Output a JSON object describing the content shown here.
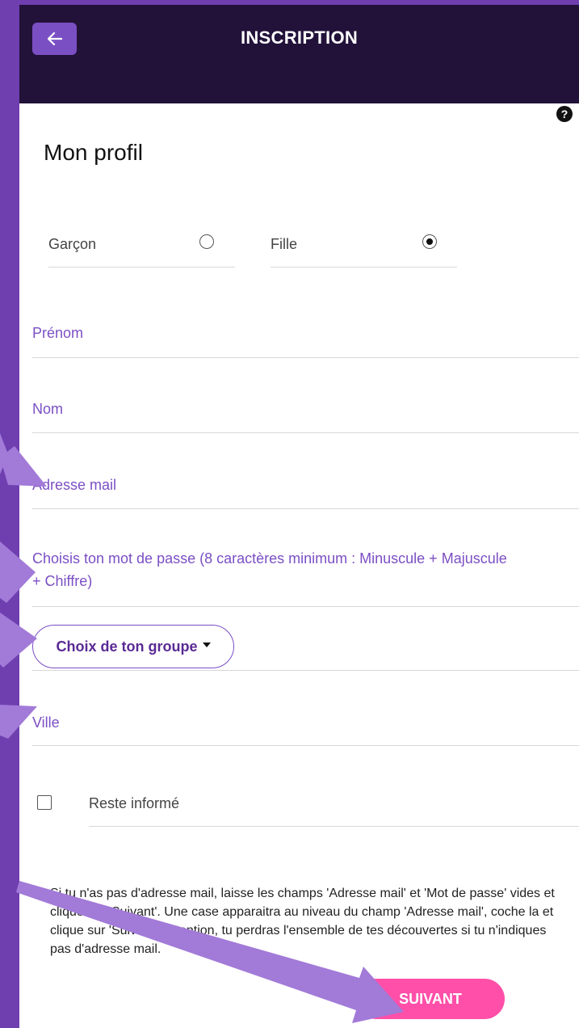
{
  "header": {
    "title": "INSCRIPTION",
    "back_icon": "arrow-left-icon",
    "help_icon": "question-circle-icon"
  },
  "page": {
    "title": "Mon profil"
  },
  "gender": {
    "options": [
      {
        "label": "Garçon",
        "selected": false
      },
      {
        "label": "Fille",
        "selected": true
      }
    ]
  },
  "form": {
    "first_name_label": "Prénom",
    "last_name_label": "Nom",
    "email_label": "Adresse mail",
    "password_label": "Choisis ton mot de passe (8 caractères minimum : Minuscule + Majuscule + Chiffre)",
    "group_button_label": "Choix de ton groupe",
    "city_label": "Ville",
    "stay_informed_label": "Reste informé",
    "stay_informed_checked": false
  },
  "notice": "Si tu n'as pas d'adresse mail, laisse les champs 'Adresse mail' et 'Mot de passe' vides et clique sur 'Suivant'. Une case apparaitra au niveau du champ 'Adresse mail', coche la et clique sur 'Suivant'. Attention, tu perdras l'ensemble de tes découvertes si tu n'indiques pas d'adresse mail.",
  "actions": {
    "next_label": "SUIVANT"
  },
  "colors": {
    "header_bg": "#22123a",
    "accent": "#7b4fc4",
    "sidebar": "#6f3fb0",
    "next_button": "#ff4fa8"
  }
}
